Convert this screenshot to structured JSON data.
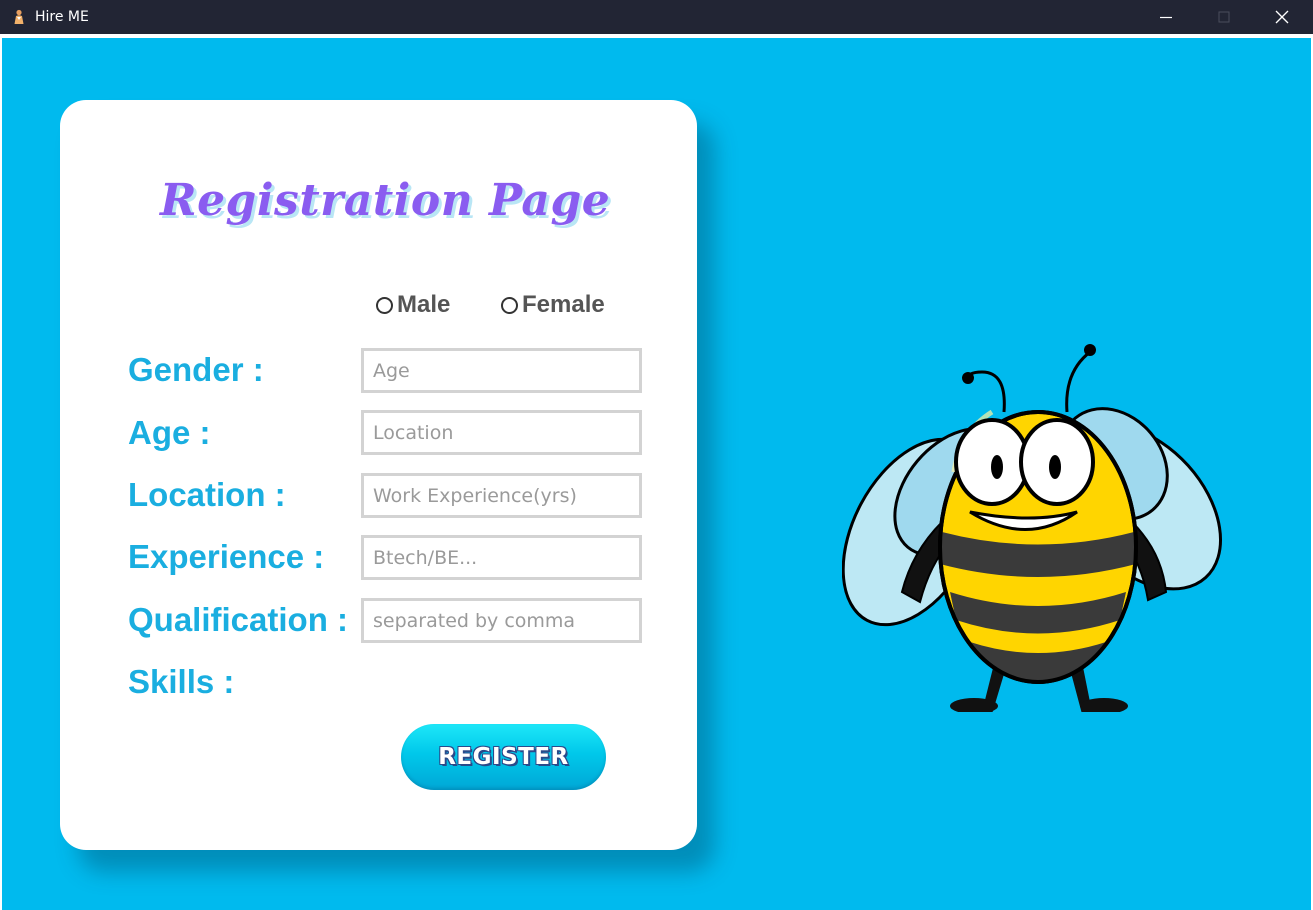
{
  "window": {
    "title": "Hire ME"
  },
  "form": {
    "title": "Registration Page",
    "gender": {
      "label": "Gender :",
      "options": [
        "Male",
        "Female"
      ]
    },
    "fields": [
      {
        "label": "Age :",
        "placeholder": "Age",
        "value": ""
      },
      {
        "label": "Location :",
        "placeholder": "Location",
        "value": ""
      },
      {
        "label": "Experience :",
        "placeholder": "Work Experience(yrs)",
        "value": ""
      },
      {
        "label": "Qualification :",
        "placeholder": "Btech/BE...",
        "value": ""
      },
      {
        "label": "Skills :",
        "placeholder": "separated by comma",
        "value": ""
      }
    ],
    "register_label": "REGISTER"
  },
  "colors": {
    "background": "#00baee",
    "title": "#8a5cf0",
    "label": "#1aaee0",
    "titlebar": "#222534"
  },
  "icons": {
    "app": "app-icon",
    "minimize": "minimize-icon",
    "maximize": "maximize-icon",
    "close": "close-icon",
    "illustration": "bee-mascot-illustration"
  }
}
